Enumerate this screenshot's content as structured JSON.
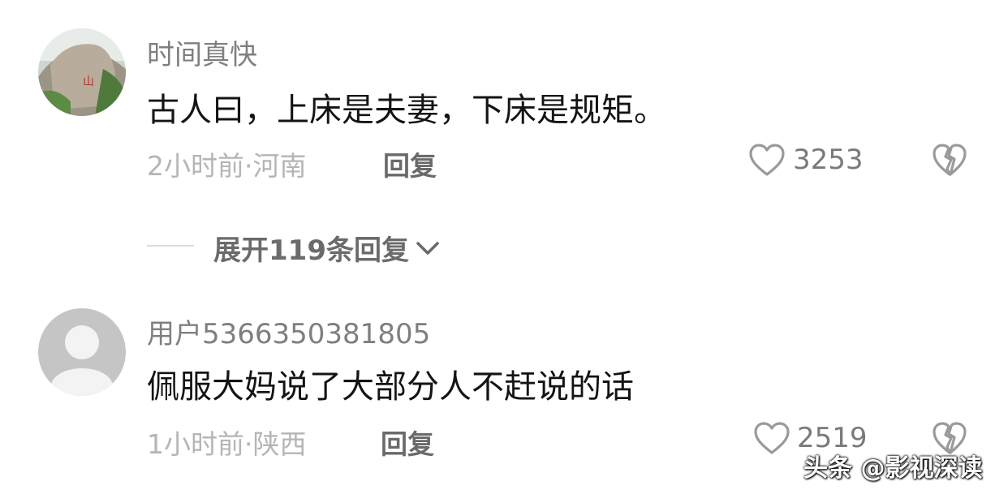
{
  "comments": [
    {
      "username": "时间真快",
      "text": "古人曰，上床是夫妻，下床是规矩。",
      "time_location": "2小时前·河南",
      "reply_label": "回复",
      "like_count": "3253",
      "avatar_icon": "rock-landscape-photo"
    },
    {
      "username": "用户5366350381805",
      "text": "佩服大妈说了大部分人不赶说的话",
      "time_location": "1小时前·陕西",
      "reply_label": "回复",
      "like_count": "2519",
      "avatar_icon": "default-user-avatar"
    }
  ],
  "expand_replies": {
    "label": "展开119条回复",
    "icon": "chevron-down-icon"
  },
  "watermark": {
    "text": "头条 @影视深读"
  },
  "colors": {
    "username": "#7f7f7f",
    "comment": "#141414",
    "meta": "#b5b5b5",
    "icons": "#9a9a9a"
  }
}
